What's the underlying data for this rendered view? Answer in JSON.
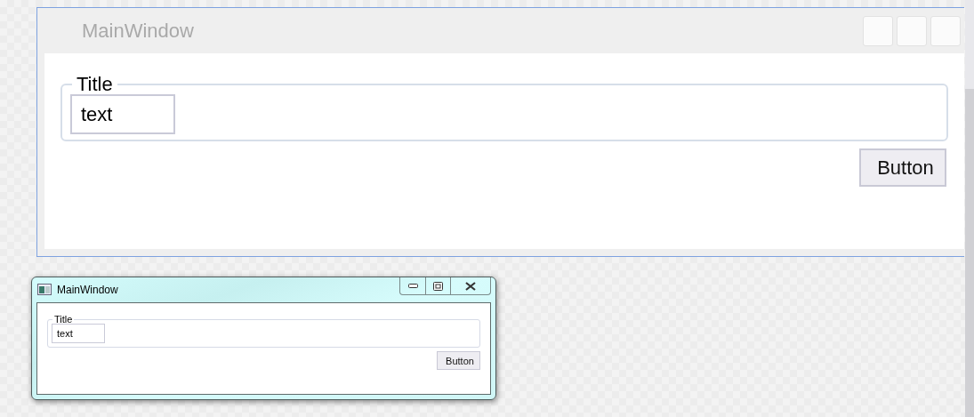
{
  "designer": {
    "title": "MainWindow",
    "group": {
      "label": "Title",
      "value": "text"
    },
    "button": "Button"
  },
  "preview": {
    "title": "MainWindow",
    "group": {
      "label": "Title",
      "value": "text"
    },
    "button": "Button"
  }
}
